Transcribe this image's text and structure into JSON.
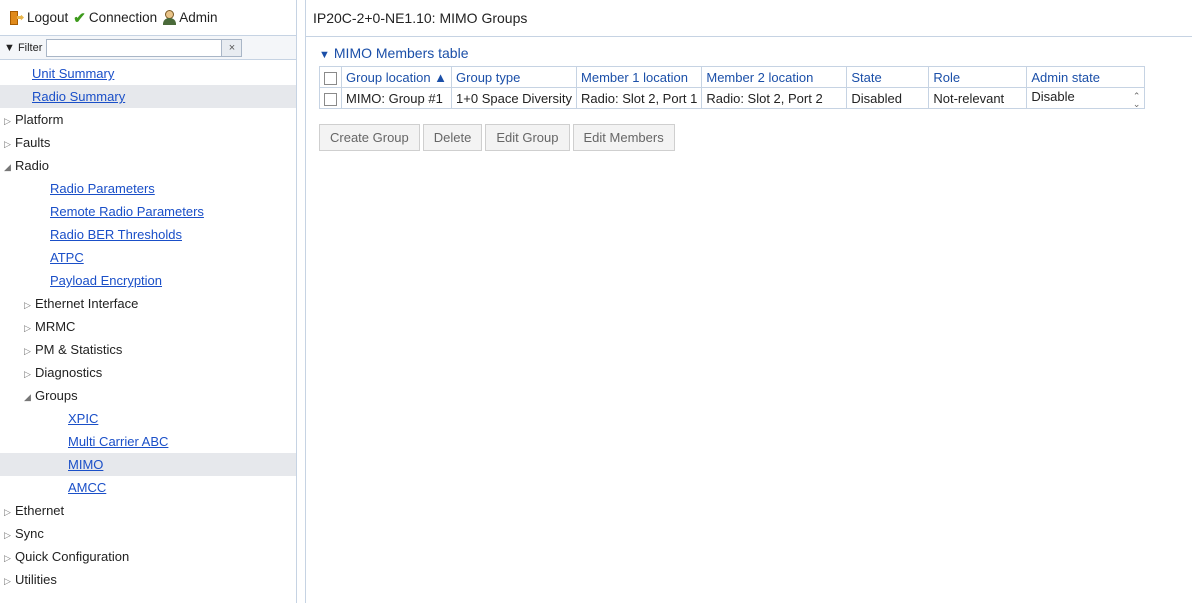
{
  "topbar": {
    "logout_label": "Logout",
    "connection_label": "Connection",
    "admin_label": "Admin"
  },
  "filter": {
    "label": "Filter",
    "value": "",
    "clear_symbol": "×"
  },
  "tree": {
    "unit_summary": "Unit Summary",
    "radio_summary": "Radio Summary",
    "platform": "Platform",
    "faults": "Faults",
    "radio": "Radio",
    "radio_parameters": "Radio Parameters",
    "remote_radio_parameters": "Remote Radio Parameters",
    "radio_ber_thresholds": "Radio BER Thresholds",
    "atpc": "ATPC",
    "payload_encryption": "Payload Encryption",
    "ethernet_interface": "Ethernet Interface",
    "mrmc": "MRMC",
    "pm_statistics": "PM & Statistics",
    "diagnostics": "Diagnostics",
    "groups": "Groups",
    "xpic": "XPIC",
    "multi_carrier_abc": "Multi Carrier ABC",
    "mimo": "MIMO",
    "amcc": "AMCC",
    "ethernet": "Ethernet",
    "sync": "Sync",
    "quick_configuration": "Quick Configuration",
    "utilities": "Utilities"
  },
  "main": {
    "title": "IP20C-2+0-NE1.10: MIMO Groups",
    "section_title": "MIMO Members table",
    "columns": [
      "Group location ▲",
      "Group type",
      "Member 1 location",
      "Member 2 location",
      "State",
      "Role",
      "Admin state"
    ],
    "rows": [
      [
        "MIMO: Group #1",
        "1+0 Space Diversity",
        "Radio: Slot 2, Port 1",
        "Radio: Slot 2, Port 2",
        "Disabled",
        "Not-relevant",
        "Disable"
      ]
    ],
    "buttons": {
      "create_group": "Create Group",
      "delete": "Delete",
      "edit_group": "Edit Group",
      "edit_members": "Edit Members"
    }
  },
  "colors": {
    "link": "#1a4fc8",
    "header_text": "#1b4fa8",
    "border": "#c6d3e3",
    "selected_bg": "#e6e8ec"
  }
}
